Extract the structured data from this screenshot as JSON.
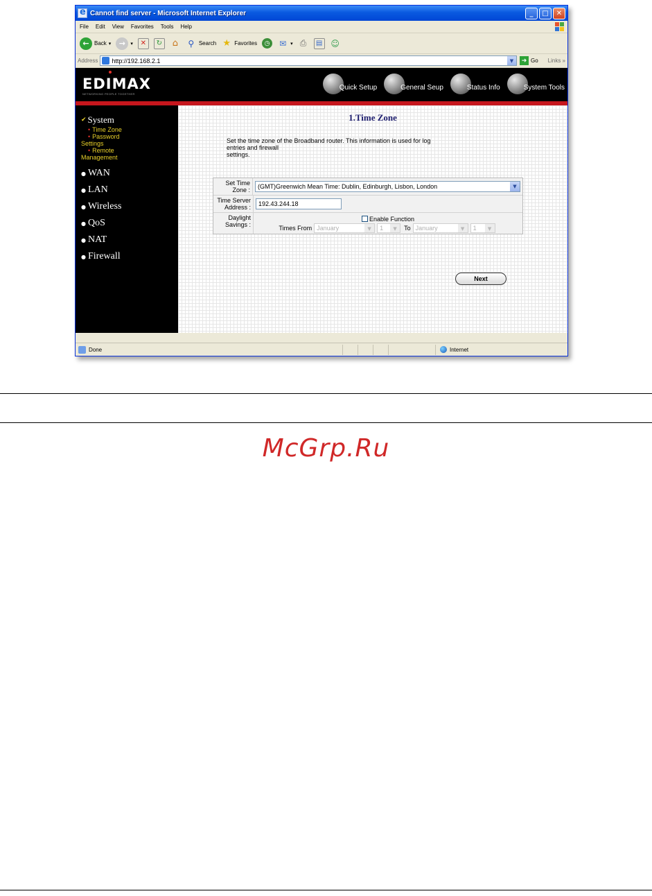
{
  "window": {
    "title": "Cannot find server - Microsoft Internet Explorer",
    "controls": {
      "minimize": "_",
      "maximize": "□",
      "close": "✕"
    }
  },
  "menu": [
    "File",
    "Edit",
    "View",
    "Favorites",
    "Tools",
    "Help"
  ],
  "toolbar": {
    "back": "Back",
    "search": "Search",
    "favorites": "Favorites"
  },
  "address": {
    "label": "Address",
    "url": "http://192.168.2.1",
    "go": "Go",
    "links": "Links »"
  },
  "brand": {
    "logo": "EDIMAX",
    "tagline": "NETWORKING PEOPLE TOGETHER"
  },
  "nav": [
    {
      "label": "Quick Setup",
      "icon": "quick-setup-globe-icon"
    },
    {
      "label": "General Seup",
      "icon": "general-setup-globe-icon"
    },
    {
      "label": "Status Info",
      "icon": "status-info-globe-icon"
    },
    {
      "label": "System Tools",
      "icon": "system-tools-globe-icon"
    }
  ],
  "sidebar": {
    "system": "System",
    "sub": {
      "time_zone": "Time Zone",
      "password_a": "Password",
      "password_b": "Settings",
      "remote_a": "Remote",
      "remote_b": "Management"
    },
    "items": [
      "WAN",
      "LAN",
      "Wireless",
      "QoS",
      "NAT",
      "Firewall"
    ]
  },
  "panel": {
    "title": "1.Time Zone",
    "description_1": "Set the time zone of the Broadband router. This information is used for log",
    "description_2": "entries and firewall",
    "description_3": "settings.",
    "fields": {
      "time_zone_label": "Set Time Zone :",
      "time_zone_value": "(GMT)Greenwich Mean Time: Dublin, Edinburgh, Lisbon, London",
      "server_label": "Time Server Address :",
      "server_value": "192.43.244.18",
      "daylight_label": "Daylight Savings :",
      "enable_label": "Enable Function",
      "times_from": "Times From",
      "from_month": "January",
      "from_day": "1",
      "to_label": "To",
      "to_month": "January",
      "to_day": "1"
    },
    "next": "Next"
  },
  "status": {
    "text": "Done",
    "zone": "Internet"
  },
  "document": {
    "watermark": "McGrp.Ru"
  },
  "colors": {
    "nav_red_line": "#c6161d",
    "sidebar_sub_text": "#e9d02a",
    "title_text": "#1e1e6e",
    "watermark": "#d02828"
  }
}
